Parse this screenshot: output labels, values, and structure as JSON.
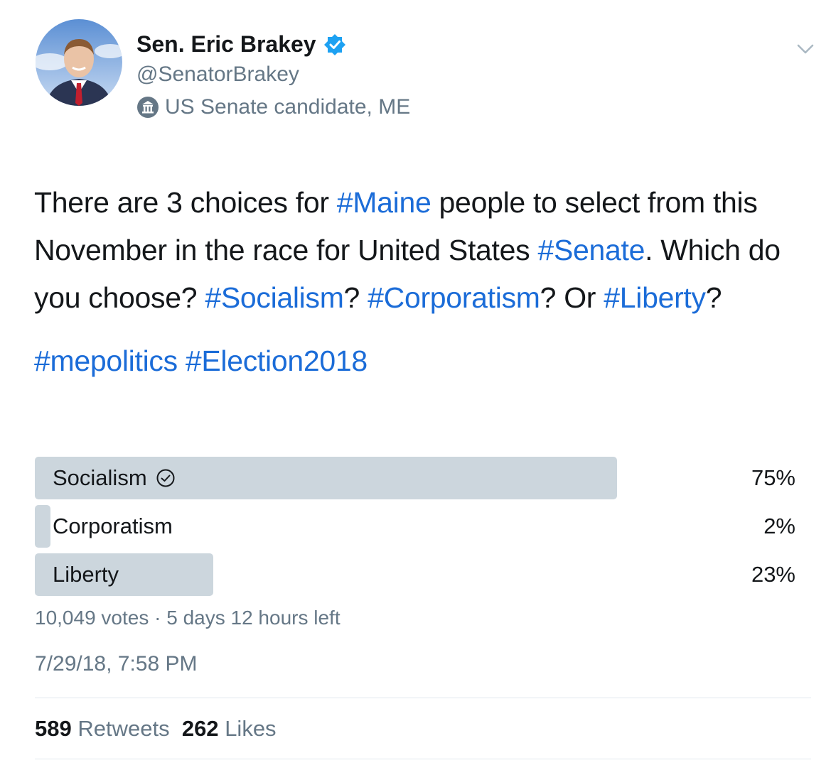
{
  "user": {
    "name": "Sen. Eric Brakey",
    "handle": "@SenatorBrakey",
    "label": "US Senate candidate, ME",
    "verified_icon": "verified-badge-icon",
    "label_icon": "government-building-icon"
  },
  "tweet": {
    "text": [
      [
        {
          "t": "There are 3 choices for ",
          "tag": false
        },
        {
          "t": "#Maine",
          "tag": true
        },
        {
          "t": " people to select from this November in the race for United States ",
          "tag": false
        },
        {
          "t": "#Senate",
          "tag": true
        },
        {
          "t": ". Which do you choose? ",
          "tag": false
        },
        {
          "t": "#Socialism",
          "tag": true
        },
        {
          "t": "? ",
          "tag": false
        },
        {
          "t": "#Corporatism",
          "tag": true
        },
        {
          "t": "? Or ",
          "tag": false
        },
        {
          "t": "#Liberty",
          "tag": true
        },
        {
          "t": "?",
          "tag": false
        }
      ],
      [
        {
          "t": "#mepolitics",
          "tag": true
        },
        {
          "t": " ",
          "tag": false
        },
        {
          "t": "#Election2018",
          "tag": true
        }
      ]
    ]
  },
  "poll": {
    "options": [
      {
        "label": "Socialism",
        "percent_text": "75%",
        "percent": 75,
        "winner": true
      },
      {
        "label": "Corporatism",
        "percent_text": "2%",
        "percent": 2,
        "winner": false
      },
      {
        "label": "Liberty",
        "percent_text": "23%",
        "percent": 23,
        "winner": false
      }
    ],
    "meta": "10,049 votes · 5 days 12 hours left"
  },
  "timestamp": "7/29/18, 7:58 PM",
  "stats": {
    "retweets_count": "589",
    "retweets_label": "Retweets",
    "likes_count": "262",
    "likes_label": "Likes"
  },
  "colors": {
    "link": "#1b6cd8",
    "bar": "#ccd6dd",
    "secondary": "#657786",
    "verified": "#1da1f2"
  }
}
